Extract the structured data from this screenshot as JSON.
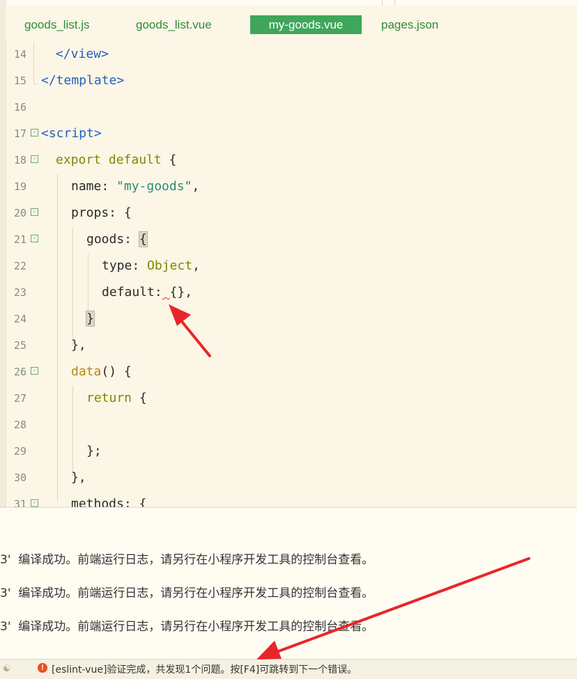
{
  "tabs": [
    {
      "label": "goods_list.js",
      "active": false
    },
    {
      "label": "goods_list.vue",
      "active": false
    },
    {
      "label": "my-goods.vue",
      "active": true
    },
    {
      "label": "pages.json",
      "active": false
    }
  ],
  "editor": {
    "lines": [
      {
        "n": "14",
        "fold": false
      },
      {
        "n": "15",
        "fold": false
      },
      {
        "n": "16",
        "fold": false
      },
      {
        "n": "17",
        "fold": true
      },
      {
        "n": "18",
        "fold": true
      },
      {
        "n": "19",
        "fold": false
      },
      {
        "n": "20",
        "fold": true
      },
      {
        "n": "21",
        "fold": true
      },
      {
        "n": "22",
        "fold": false
      },
      {
        "n": "23",
        "fold": false
      },
      {
        "n": "24",
        "fold": false
      },
      {
        "n": "25",
        "fold": false
      },
      {
        "n": "26",
        "fold": true
      },
      {
        "n": "27",
        "fold": false
      },
      {
        "n": "28",
        "fold": false
      },
      {
        "n": "29",
        "fold": false
      },
      {
        "n": "30",
        "fold": false
      },
      {
        "n": "31",
        "fold": true
      }
    ],
    "code": {
      "l14": "</view>",
      "l15": "</template>",
      "l17": "<script>",
      "l18_kw": "export default",
      "l18_rest": " {",
      "l19_key": "name: ",
      "l19_str": "\"my-goods\"",
      "l19_rest": ",",
      "l20": "props: {",
      "l21_key": "goods: ",
      "l21_brace": "{",
      "l22_key": "type: ",
      "l22_val": "Object",
      "l22_rest": ",",
      "l23_key": "default:",
      "l23_sp": " ",
      "l23_val": "{},",
      "l24": "}",
      "l25": "},",
      "l26_fn": "data",
      "l26_rest": "() {",
      "l27_kw": "return",
      "l27_rest": " {",
      "l29": "};",
      "l30": "},",
      "l31": "methods: {"
    }
  },
  "console": {
    "lines": [
      "3'  编译成功。前端运行日志，请另行在小程序开发工具的控制台查看。",
      "3'  编译成功。前端运行日志，请另行在小程序开发工具的控制台查看。",
      "3'  编译成功。前端运行日志，请另行在小程序开发工具的控制台查看。"
    ]
  },
  "statusbar": {
    "warning_icon": "!",
    "message": "[eslint-vue]验证完成，共发现1个问题。按[F4]可跳转到下一个错误。"
  },
  "colors": {
    "active_tab": "#3fa65b",
    "tag": "#2660bf",
    "keyword": "#7f8700",
    "string": "#2b8a78",
    "arrow": "#e8262a"
  }
}
